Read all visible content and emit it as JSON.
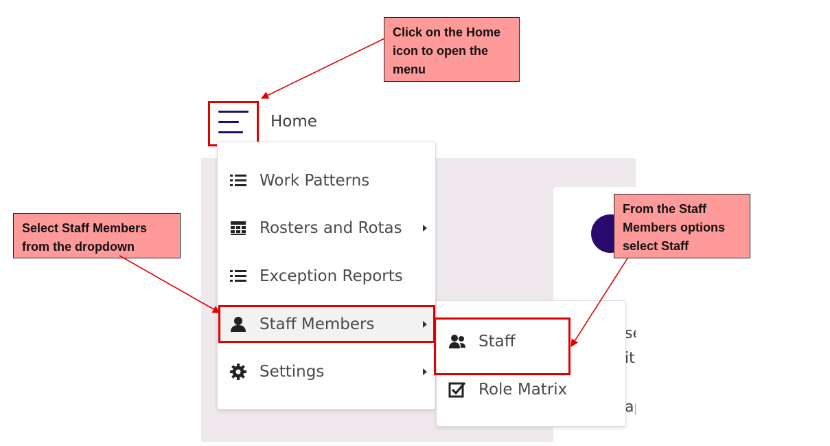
{
  "header": {
    "home_label": "Home",
    "menu_icon": "hamburger-menu-icon"
  },
  "menu": {
    "items": [
      {
        "label": "Work Patterns",
        "icon": "list-icon",
        "has_submenu": false
      },
      {
        "label": "Rosters and Rotas",
        "icon": "calendar-icon",
        "has_submenu": true
      },
      {
        "label": "Exception Reports",
        "icon": "list-icon",
        "has_submenu": false
      },
      {
        "label": "Staff Members",
        "icon": "user-icon",
        "has_submenu": true,
        "active": true
      },
      {
        "label": "Settings",
        "icon": "gear-icon",
        "has_submenu": true
      }
    ]
  },
  "submenu": {
    "items": [
      {
        "label": "Staff",
        "icon": "users-icon"
      },
      {
        "label": "Role Matrix",
        "icon": "checkbox-icon"
      }
    ]
  },
  "background": {
    "fragments": [
      "se",
      "it",
      "ap"
    ]
  },
  "callouts": {
    "home": "Click on the Home icon to open the menu",
    "staff_members": "Select Staff Members from the dropdown",
    "staff": "From the Staff Members options select Staff"
  },
  "colors": {
    "accent": "#2b0a6e",
    "highlight": "#e00000",
    "callout_bg": "#ff9a9a",
    "panel_bg": "#efe9ee"
  }
}
